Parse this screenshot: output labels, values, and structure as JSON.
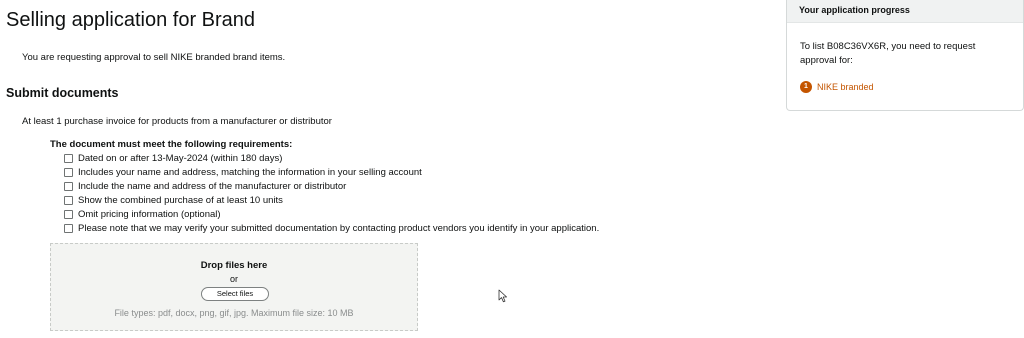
{
  "page": {
    "title": "Selling application for Brand",
    "intro": "You are requesting approval to sell NIKE branded brand items."
  },
  "documents": {
    "section_title": "Submit documents",
    "doc_type": "At least 1 purchase invoice for products from a manufacturer or distributor",
    "requirements_heading": "The document must meet the following requirements:",
    "requirements": [
      {
        "label": "Dated on or after 13-May-2024 (within 180 days)",
        "checked": false
      },
      {
        "label": "Includes your name and address, matching the information in your selling account",
        "checked": false
      },
      {
        "label": "Include the name and address of the manufacturer or distributor",
        "checked": false
      },
      {
        "label": "Show the combined purchase of at least 10 units",
        "checked": false
      },
      {
        "label": "Omit pricing information (optional)",
        "checked": false
      },
      {
        "label": "Please note that we may verify your submitted documentation by contacting product vendors you identify in your application.",
        "checked": false
      }
    ]
  },
  "upload": {
    "drop_title": "Drop files here",
    "or_text": "or",
    "select_button": "Select files",
    "file_note": "File types: pdf, docx, png, gif, jpg. Maximum file size: 10 MB"
  },
  "progress": {
    "header": "Your application progress",
    "text": "To list B08C36VX6R, you need to request approval for:",
    "steps": [
      {
        "number": "1",
        "label": "NIKE branded",
        "color": "#c45500"
      }
    ]
  },
  "colors": {
    "accent": "#c45500",
    "dropzone_bg": "#f3f4f2",
    "panel_header_bg": "#f0f2f2"
  }
}
